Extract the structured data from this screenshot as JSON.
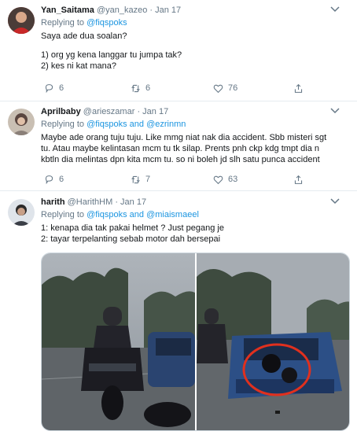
{
  "tweets": [
    {
      "name": "Yan_Saitama",
      "handle": "@yan_kazeo",
      "sep": "·",
      "date": "Jan 17",
      "replying_prefix": "Replying to",
      "mentions": "@fiqspoks",
      "lines": [
        "Saya ade dua soalan?",
        "",
        "1) org yg kena langgar tu jumpa tak?",
        "2) kes ni kat mana?"
      ],
      "counts": {
        "reply": "6",
        "retweet": "6",
        "like": "76"
      }
    },
    {
      "name": "Aprilbaby",
      "handle": "@arieszamar",
      "sep": "·",
      "date": "Jan 17",
      "replying_prefix": "Replying to",
      "mentions": "@fiqspoks and @ezrinmn",
      "lines": [
        "Maybe ade orang tuju tuju. Like mmg niat nak dia accident. Sbb misteri sgt",
        "tu. Atau maybe kelintasan mcm tu tk silap. Prents pnh ckp kdg tmpt dia n",
        "kbtln dia melintas dpn kita mcm tu. so ni boleh jd slh satu punca accident"
      ],
      "counts": {
        "reply": "6",
        "retweet": "7",
        "like": "63"
      }
    },
    {
      "name": "harith",
      "handle": "@HarithHM",
      "sep": "·",
      "date": "Jan 17",
      "replying_prefix": "Replying to",
      "mentions": "@fiqspoks and @miaismaeel",
      "lines": [
        "1: kenapa dia tak pakai helmet ? Just pegang je",
        "2: tayar terpelanting sebab motor dah bersepai"
      ]
    }
  ],
  "colors": {
    "accent": "#1b95e0",
    "muted": "#657786",
    "text": "#14171a",
    "highlight": "#e0301e"
  },
  "icons": [
    "chevron-down-icon",
    "reply-icon",
    "retweet-icon",
    "like-icon",
    "share-icon"
  ]
}
